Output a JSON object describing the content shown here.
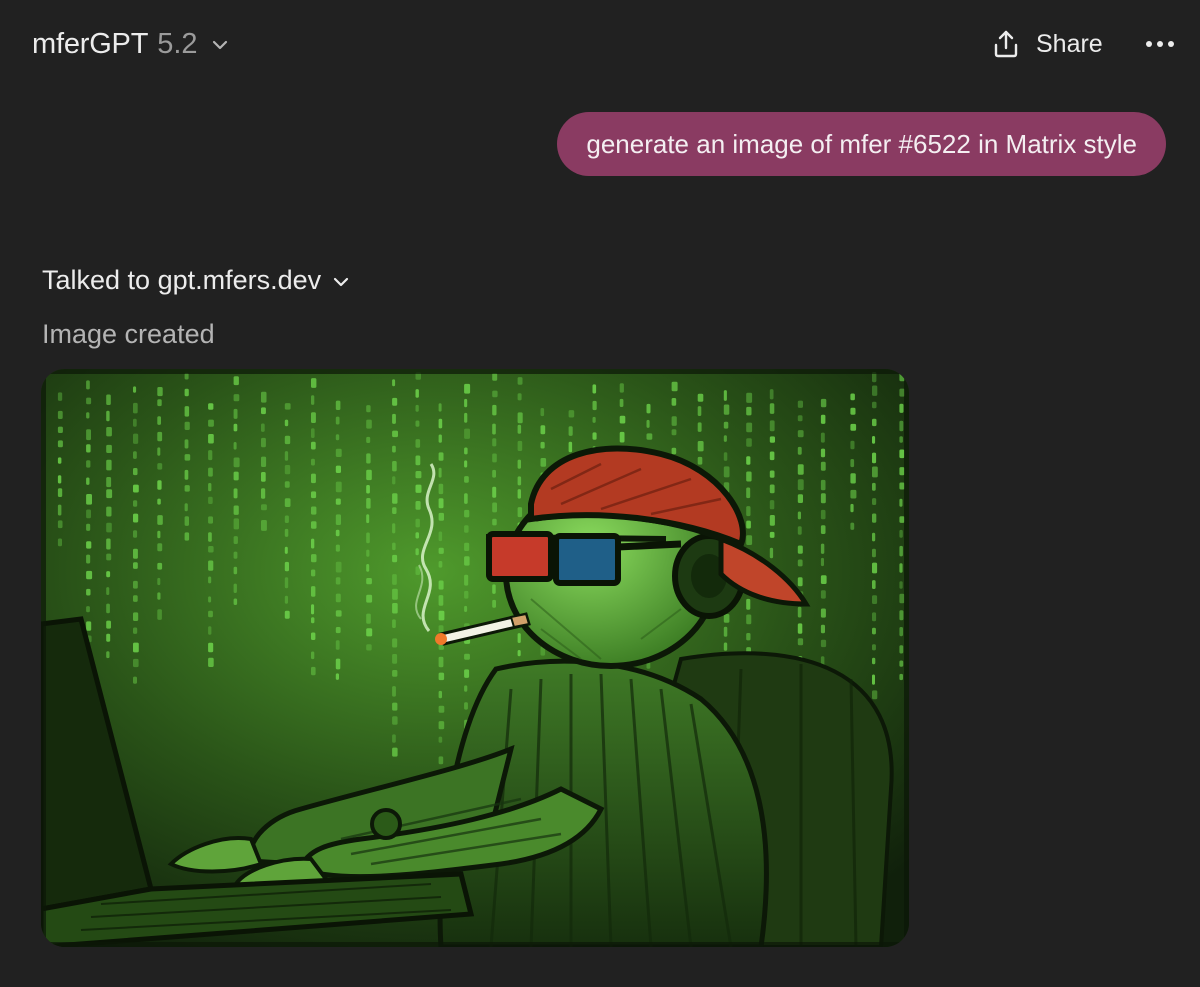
{
  "header": {
    "model_name": "mferGPT",
    "model_version": "5.2",
    "share_label": "Share"
  },
  "conversation": {
    "user_message": "generate an image of mfer #6522 in Matrix style",
    "tool_call_label": "Talked to gpt.mfers.dev",
    "image_status": "Image created"
  },
  "image": {
    "subject": "mfer character with red backwards cap, red-blue 3D glasses, headphones and cigarette typing at a laptop in front of green Matrix code rain"
  },
  "colors": {
    "background": "#212121",
    "user_bubble": "#8a3b62",
    "text_primary": "#ececec",
    "text_secondary": "#b4b4b4",
    "matrix_green": "#6cd24a"
  },
  "icons": {
    "model_chevron": "chevron-down-icon",
    "share": "share-upload-icon",
    "more": "more-horizontal-icon",
    "tool_chevron": "chevron-down-icon"
  }
}
